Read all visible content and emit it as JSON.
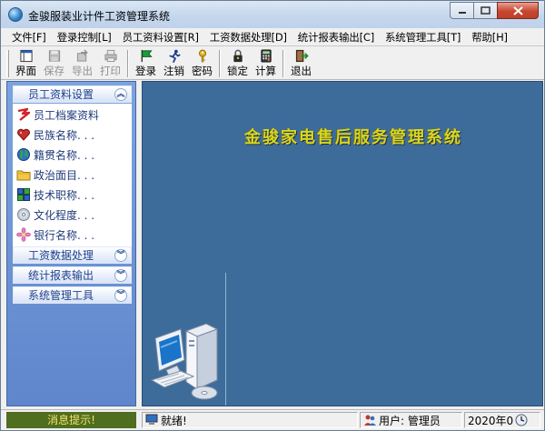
{
  "window": {
    "title": "金骏服装业计件工资管理系统",
    "controls": [
      "minimize",
      "maximize",
      "close"
    ]
  },
  "menu": [
    "文件[F]",
    "登录控制[L]",
    "员工资料设置[R]",
    "工资数据处理[D]",
    "统计报表输出[C]",
    "系统管理工具[T]",
    "帮助[H]"
  ],
  "toolbar": {
    "buttons": [
      {
        "label": "界面",
        "icon": "window-icon",
        "enabled": true
      },
      {
        "label": "保存",
        "icon": "save-icon",
        "enabled": false
      },
      {
        "label": "导出",
        "icon": "export-icon",
        "enabled": false
      },
      {
        "label": "打印",
        "icon": "print-icon",
        "enabled": false
      },
      {
        "label": "登录",
        "icon": "flag-icon",
        "enabled": true
      },
      {
        "label": "注销",
        "icon": "runner-icon",
        "enabled": true
      },
      {
        "label": "密码",
        "icon": "key-icon",
        "enabled": true
      },
      {
        "label": "锁定",
        "icon": "lock-icon",
        "enabled": true
      },
      {
        "label": "计算",
        "icon": "calculator-icon",
        "enabled": true
      },
      {
        "label": "退出",
        "icon": "exit-icon",
        "enabled": true
      }
    ]
  },
  "sidebar": {
    "groups": [
      {
        "label": "员工资料设置",
        "expanded": true
      },
      {
        "label": "工资数据处理",
        "expanded": false
      },
      {
        "label": "统计报表输出",
        "expanded": false
      },
      {
        "label": "系统管理工具",
        "expanded": false
      }
    ],
    "items": [
      {
        "label": "员工档案资料",
        "icon": "staff-file-icon"
      },
      {
        "label": "民族名称. . .",
        "icon": "heart-icon"
      },
      {
        "label": "籍贯名称. . .",
        "icon": "globe-icon"
      },
      {
        "label": "政治面目. . .",
        "icon": "folder-icon"
      },
      {
        "label": "技术职称. . .",
        "icon": "blocks-icon"
      },
      {
        "label": "文化程度. . .",
        "icon": "disc-icon"
      },
      {
        "label": "银行名称. . .",
        "icon": "flower-icon"
      }
    ]
  },
  "main": {
    "banner": "金骏家电售后服务管理系统",
    "colors": {
      "background": "#3d6c9b",
      "banner": "#d9d61f"
    }
  },
  "status": {
    "message_label": "消息提示!",
    "ready_text": "就绪!",
    "user_text": "用户: 管理员",
    "date_text": "2020年0"
  }
}
